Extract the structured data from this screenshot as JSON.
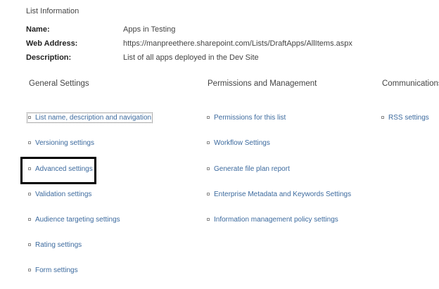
{
  "list_information": {
    "title": "List Information",
    "name_label": "Name:",
    "name_value": "Apps in Testing",
    "web_address_label": "Web Address:",
    "web_address_value": "https://manpreethere.sharepoint.com/Lists/DraftApps/AllItems.aspx",
    "description_label": "Description:",
    "description_value": "List of all apps deployed in the Dev Site"
  },
  "general_settings": {
    "heading": "General Settings",
    "items": [
      {
        "label": "List name, description and navigation"
      },
      {
        "label": "Versioning settings"
      },
      {
        "label": "Advanced settings"
      },
      {
        "label": "Validation settings"
      },
      {
        "label": "Audience targeting settings"
      },
      {
        "label": "Rating settings"
      },
      {
        "label": "Form settings"
      }
    ]
  },
  "permissions_management": {
    "heading": "Permissions and Management",
    "items": [
      {
        "label": "Permissions for this list"
      },
      {
        "label": "Workflow Settings"
      },
      {
        "label": "Generate file plan report"
      },
      {
        "label": "Enterprise Metadata and Keywords Settings"
      },
      {
        "label": "Information management policy settings"
      }
    ]
  },
  "communications": {
    "heading": "Communications",
    "items": [
      {
        "label": "RSS settings"
      }
    ]
  },
  "colors": {
    "link": "#3c6a9e",
    "highlight_border": "#000000"
  }
}
